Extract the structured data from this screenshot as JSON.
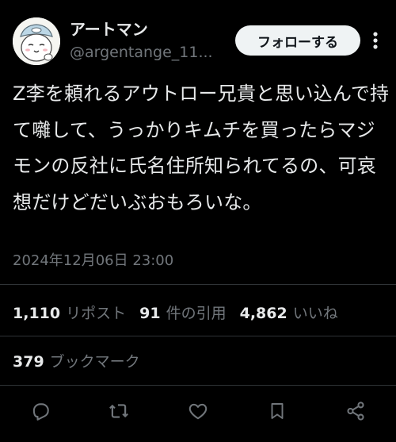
{
  "user": {
    "display_name": "アートマン",
    "handle": "@argentange_11...",
    "avatar_icon": "cartoon-character-avatar"
  },
  "follow_button": {
    "label": "フォローする"
  },
  "more_icon": "more-vertical-icon",
  "tweet": {
    "text": "Z李を頼れるアウトロー兄貴と思い込んで持て囃して、うっかりキムチを買ったらマジモンの反社に氏名住所知られてるの、可哀想だけどだいぶおもろいな。",
    "timestamp": "2024年12月06日 23:00"
  },
  "stats": {
    "reposts_count": "1,110",
    "reposts_label": "リポスト",
    "quotes_count": "91",
    "quotes_label": "件の引用",
    "likes_count": "4,862",
    "likes_label": "いいね"
  },
  "bookmarks": {
    "count": "379",
    "label": "ブックマーク"
  },
  "actions": {
    "reply_icon": "reply-icon",
    "repost_icon": "repost-icon",
    "like_icon": "heart-icon",
    "bookmark_icon": "bookmark-icon",
    "share_icon": "share-icon"
  },
  "colors": {
    "background": "#000000",
    "primary_text": "#e7e9ea",
    "secondary_text": "#71767b",
    "divider": "#2f3336",
    "follow_bg": "#eff3f4"
  }
}
